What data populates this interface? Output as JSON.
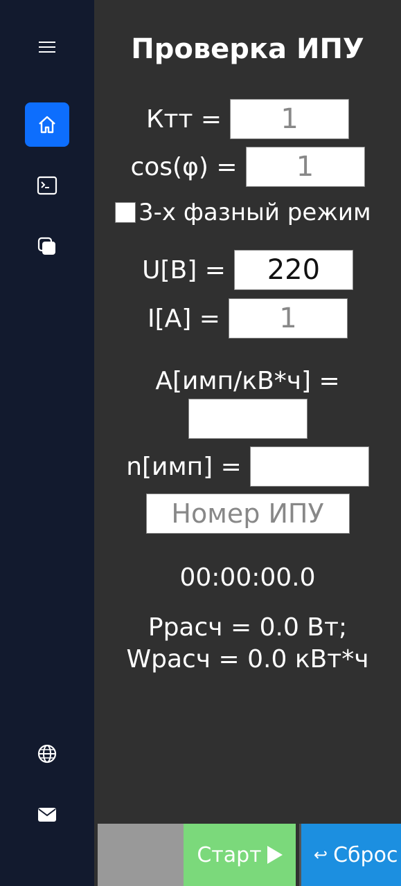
{
  "sidebar": {
    "icons": [
      "menu-icon",
      "home-icon",
      "terminal-icon",
      "copy-icon",
      "globe-icon",
      "mail-icon"
    ],
    "active": "home-icon",
    "accent_color": "#0d6efd"
  },
  "main": {
    "title": "Проверка ИПУ",
    "ktt": {
      "label": "Ктт =",
      "placeholder": "1"
    },
    "cos": {
      "label": "cos(φ) =",
      "placeholder": "1"
    },
    "three_phase": {
      "label": "3-х фазный режим",
      "checked": false
    },
    "u": {
      "label": "U[B] =",
      "value": "220"
    },
    "i": {
      "label": "I[A] =",
      "placeholder": "1"
    },
    "a": {
      "label": "A[имп/кВ*ч] =",
      "value": ""
    },
    "n": {
      "label": "n[имп] =",
      "value": ""
    },
    "meter_number": {
      "placeholder": "Номер ИПУ"
    },
    "timer": "00:00:00.0",
    "p_calc": "Ррасч = 0.0 Вт;",
    "w_calc": "Wрасч = 0.0 кВт*ч"
  },
  "buttons": {
    "start": "Старт",
    "reset": "Сброс",
    "start_color": "#7bd97b",
    "reset_color": "#1c8fe0"
  }
}
